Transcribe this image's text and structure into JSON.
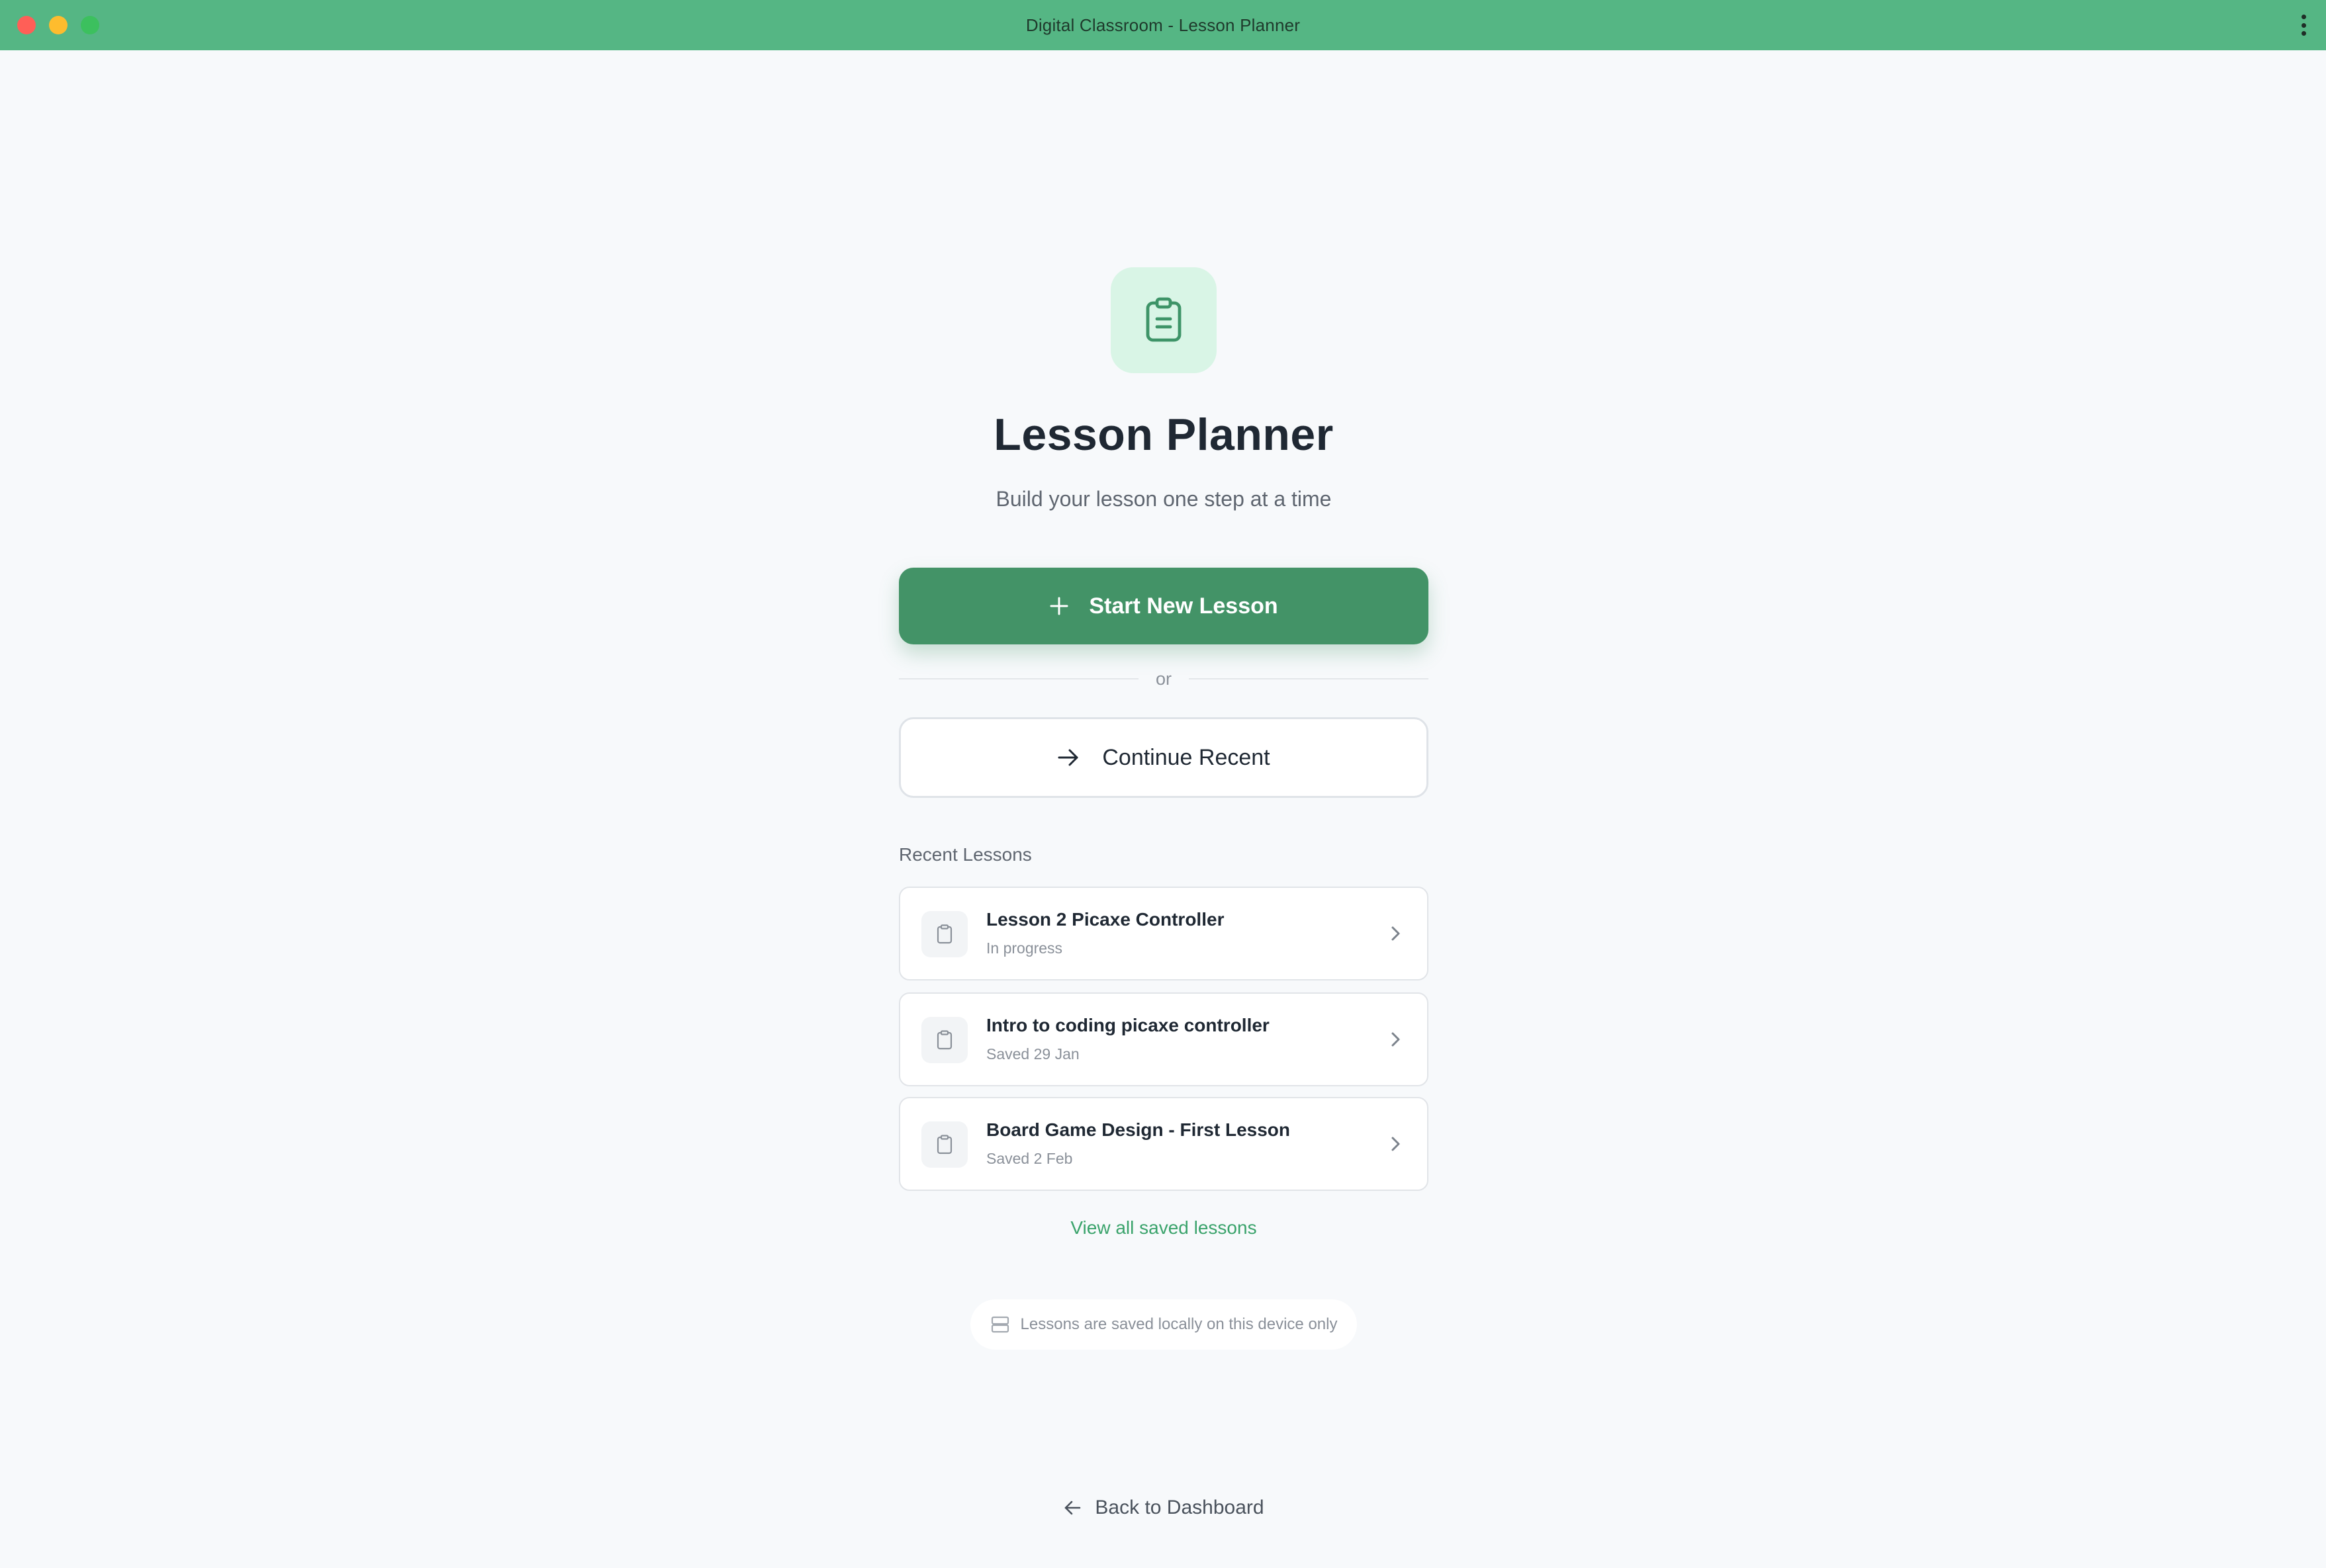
{
  "window": {
    "title": "Digital Classroom - Lesson Planner"
  },
  "header": {
    "title": "Lesson Planner",
    "subtitle": "Build your lesson one step at a time",
    "icon": "clipboard-icon"
  },
  "actions": {
    "start_new": "Start New Lesson",
    "or": "or",
    "continue_recent": "Continue Recent"
  },
  "recent": {
    "label": "Recent Lessons",
    "items": [
      {
        "name": "Lesson 2 Picaxe Controller",
        "status": "In progress"
      },
      {
        "name": "Intro to coding picaxe controller",
        "status": "Saved 29 Jan"
      },
      {
        "name": "Board Game Design - First Lesson",
        "status": "Saved 2 Feb"
      }
    ],
    "view_all": "View all saved lessons"
  },
  "storage_note": "Lessons are saved locally on this device only",
  "footer": {
    "back": "Back to Dashboard"
  },
  "colors": {
    "titlebar": "#55b684",
    "primary": "#439367",
    "link": "#3aa36b",
    "icon_tile": "#d9f5e6"
  }
}
